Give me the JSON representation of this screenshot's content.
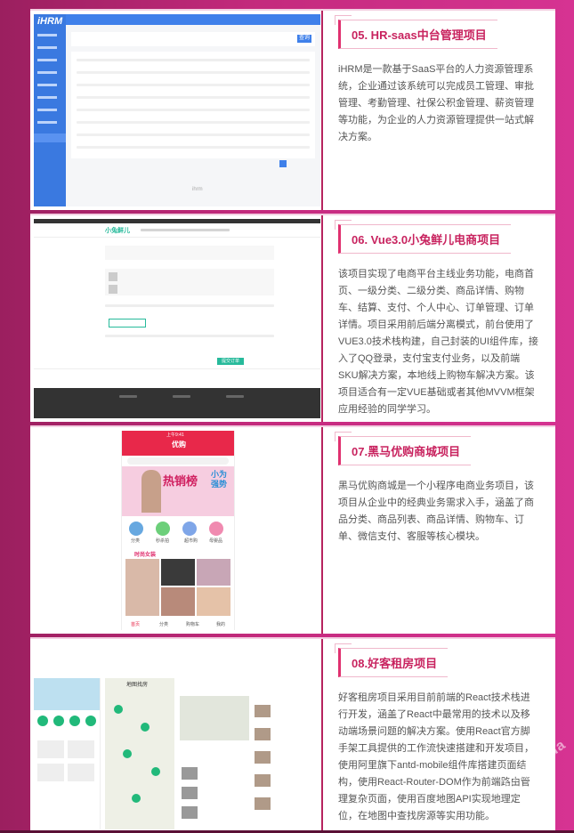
{
  "projects": [
    {
      "title": "05. HR-saas中台管理项目",
      "desc": "iHRM是一款基于SaaS平台的人力资源管理系统，企业通过该系统可以完成员工管理、审批管理、考勤管理、社保公积金管理、薪资管理等功能，为企业的人力资源管理提供一站式解决方案。",
      "shot": {
        "logo": "iHRM",
        "filter_button": "查询",
        "footer_hint": "ihrm"
      }
    },
    {
      "title": "06. Vue3.0小兔鲜儿电商项目",
      "desc": "该项目实现了电商平台主线业务功能，电商首页、一级分类、二级分类、商品详情、购物车、结算、支付、个人中心、订单管理、订单详情。项目采用前后端分离模式，前台使用了VUE3.0技术栈构建，自己封装的UI组件库，接入了QQ登录，支付宝支付业务，以及前端SKU解决方案，本地线上购物车解决方案。该项目适合有一定VUE基础或者其他MVVM框架应用经验的同学学习。",
      "shot": {
        "logo": "小兔鲜儿",
        "submit_button": "提交订单"
      }
    },
    {
      "title": "07.黑马优购商城项目",
      "desc": "黑马优购商城是一个小程序电商业务项目，该项目从企业中的经典业务需求入手，涵盖了商品分类、商品列表、商品详情、购物车、订单、微信支付、客服等核心模块。",
      "shot": {
        "status": "上午9:41",
        "app_title": "优购",
        "banner_text": "热销榜",
        "banner_side": "小为 强势",
        "icons": [
          "分类",
          "秒杀拍",
          "超市购",
          "母婴品"
        ],
        "section": "时尚女装",
        "tabs": [
          "首页",
          "分类",
          "购物车",
          "我的"
        ]
      }
    },
    {
      "title": "08.好客租房项目",
      "desc": "好客租房项目采用目前前端的React技术栈进行开发，涵盖了React中最常用的技术以及移动端场景问题的解决方案。使用React官方脚手架工具提供的工作流快速搭建和开发项目，使用阿里旗下antd-mobile组件库搭建页面结构，使用React-Router-DOM作为前端路由管理复杂页面，使用百度地图API实现地理定位，在地图中查找房源等实用功能。",
      "shot": {
        "map_title": "地图找房"
      }
    }
  ],
  "watermark": "https://ua"
}
